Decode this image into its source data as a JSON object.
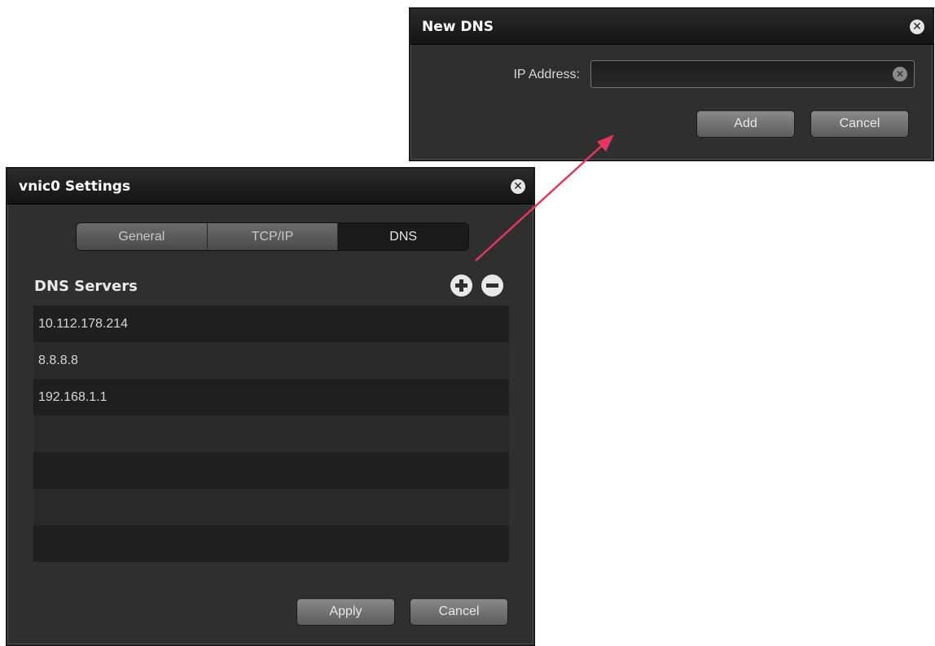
{
  "new_dns_dialog": {
    "title": "New DNS",
    "close_glyph": "✕",
    "ip_label": "IP Address:",
    "ip_value": "",
    "clear_glyph": "✕",
    "add_label": "Add",
    "cancel_label": "Cancel"
  },
  "vnic_dialog": {
    "title": "vnic0 Settings",
    "close_glyph": "✕",
    "tabs": [
      {
        "label": "General",
        "active": false
      },
      {
        "label": "TCP/IP",
        "active": false
      },
      {
        "label": "DNS",
        "active": true
      }
    ],
    "section_title": "DNS Servers",
    "add_icon": "plus-circle-icon",
    "remove_icon": "minus-circle-icon",
    "dns_servers": [
      "10.112.178.214",
      "8.8.8.8",
      "192.168.1.1",
      "",
      "",
      "",
      ""
    ],
    "apply_label": "Apply",
    "cancel_label": "Cancel"
  },
  "colors": {
    "annotation_arrow": "#e8355c",
    "dialog_bg": "#2f2f2f",
    "titlebar": "#1a1a1a"
  }
}
